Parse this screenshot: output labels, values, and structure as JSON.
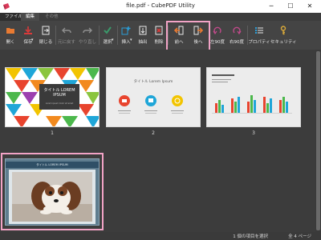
{
  "window": {
    "title": "file.pdf - CubePDF Utility",
    "minimize": "─",
    "maximize": "☐",
    "close": "✕"
  },
  "tabs": [
    {
      "label": "ファイル"
    },
    {
      "label": "編集"
    },
    {
      "label": "その他"
    }
  ],
  "toolbar": {
    "buttons": [
      {
        "label": "開く",
        "icon": "open-folder-icon",
        "color": "#e87a32"
      },
      {
        "label": "保存",
        "icon": "save-icon",
        "color": "#d93a3a"
      },
      {
        "label": "閉じる",
        "icon": "close-file-icon",
        "color": "#e8e8e8"
      },
      {
        "label": "元に戻す",
        "icon": "undo-icon",
        "color": "#8f8f8f"
      },
      {
        "label": "やり直し",
        "icon": "redo-icon",
        "color": "#8f8f8f"
      },
      {
        "label": "選択",
        "icon": "select-icon",
        "color": "#3a9a6a"
      },
      {
        "label": "挿入",
        "icon": "insert-icon",
        "color": "#2a9ed8"
      },
      {
        "label": "抽出",
        "icon": "extract-icon",
        "color": "#e8e8e8"
      },
      {
        "label": "削除",
        "icon": "delete-icon",
        "color": "#d93a3a"
      },
      {
        "label": "前へ",
        "icon": "move-previous-icon",
        "color": "#e87a32"
      },
      {
        "label": "後へ",
        "icon": "move-next-icon",
        "color": "#e87a32"
      },
      {
        "label": "左90度",
        "icon": "rotate-left-icon",
        "color": "#c04a8a"
      },
      {
        "label": "右90度",
        "icon": "rotate-right-icon",
        "color": "#c04a8a"
      },
      {
        "label": "プロパティ",
        "icon": "properties-icon",
        "color": "#2a9ed8"
      },
      {
        "label": "セキュリティ",
        "icon": "security-key-icon",
        "color": "#d9a93a"
      }
    ]
  },
  "pages": [
    {
      "number": "1",
      "title_lines": [
        "タイトル LOREM",
        "IPSUM"
      ],
      "subtitle": "Lorem ipsum dolor sit amet"
    },
    {
      "number": "2",
      "title": "タイトル Lorem Ipsum"
    },
    {
      "number": "3"
    },
    {
      "number": "",
      "title": "タイトル LOREM IPSUM"
    }
  ],
  "status": {
    "selection": "1 個の項目を選択",
    "pages": "全 4 ページ"
  },
  "colors": {
    "accent_highlight": "#f2a3c6",
    "workspace_bg": "#3c3c3c",
    "toolbar_bg": "#444444"
  }
}
